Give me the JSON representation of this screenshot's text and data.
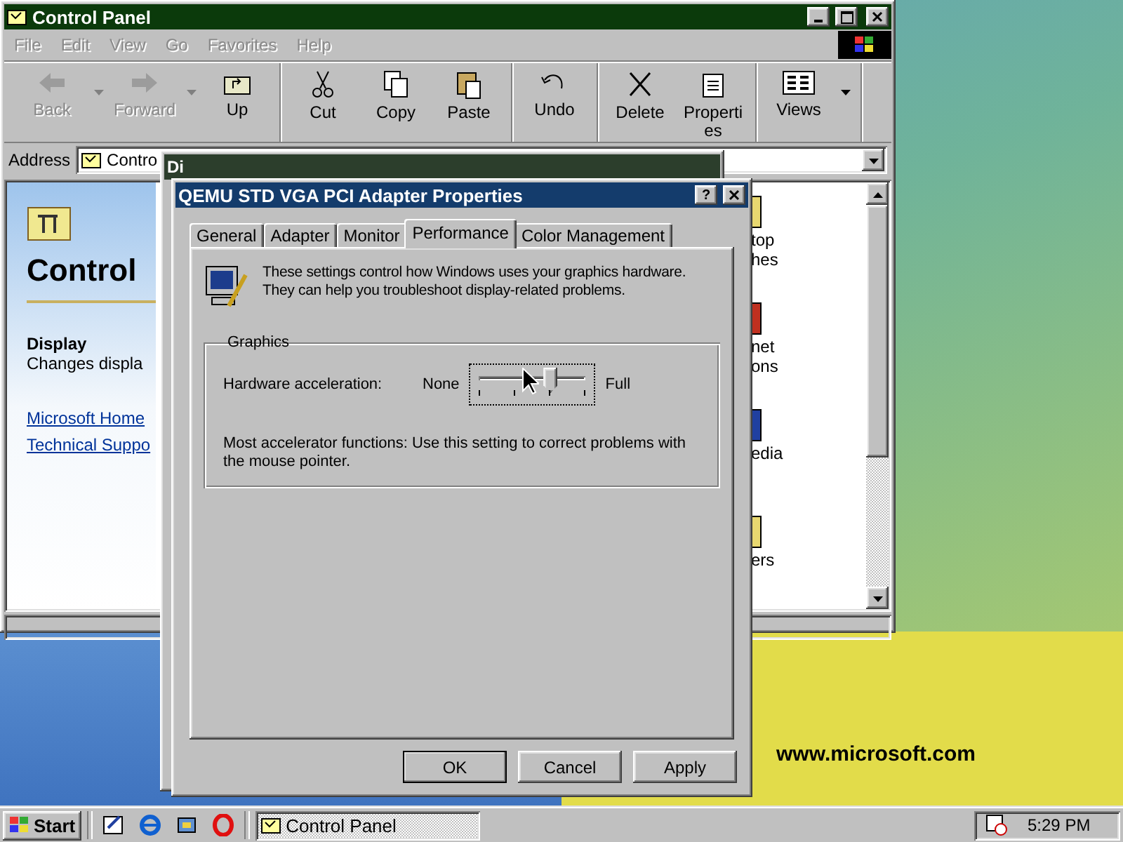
{
  "control_panel": {
    "title": "Control Panel",
    "menu": [
      "File",
      "Edit",
      "View",
      "Go",
      "Favorites",
      "Help"
    ],
    "toolbar_groups": [
      [
        {
          "label": "Back",
          "disabled": true,
          "dropdown": true
        },
        {
          "label": "Forward",
          "disabled": true,
          "dropdown": true
        },
        {
          "label": "Up",
          "disabled": false,
          "dropdown": false
        }
      ],
      [
        {
          "label": "Cut",
          "disabled": false,
          "dropdown": false
        },
        {
          "label": "Copy",
          "disabled": false,
          "dropdown": false
        },
        {
          "label": "Paste",
          "disabled": false,
          "dropdown": false
        }
      ],
      [
        {
          "label": "Undo",
          "disabled": false,
          "dropdown": false
        }
      ],
      [
        {
          "label": "Delete",
          "disabled": false,
          "dropdown": false
        },
        {
          "label": "Properties",
          "disabled": false,
          "dropdown": false
        }
      ],
      [
        {
          "label": "Views",
          "disabled": false,
          "dropdown": true
        }
      ]
    ],
    "address": {
      "label": "Address",
      "value": "Contro"
    },
    "web_panel": {
      "heading": "Control",
      "item_title": "Display",
      "item_description": "Changes displa",
      "links": [
        "Microsoft Home",
        "Technical Suppo"
      ]
    },
    "icon_labels": [
      {
        "lines": [
          "top",
          "hes"
        ]
      },
      {
        "lines": [
          "net",
          "ons"
        ]
      },
      {
        "lines": [
          "edia"
        ]
      },
      {
        "lines": [
          "ers"
        ]
      }
    ]
  },
  "background_dialog": {
    "title": "Di"
  },
  "dialog": {
    "title": "QEMU STD VGA PCI Adapter Properties",
    "help_button": "?",
    "tabs": [
      {
        "label": "General",
        "selected": false
      },
      {
        "label": "Adapter",
        "selected": false
      },
      {
        "label": "Monitor",
        "selected": false
      },
      {
        "label": "Performance",
        "selected": true
      },
      {
        "label": "Color Management",
        "selected": false
      }
    ],
    "intro": "These settings control how Windows uses your graphics hardware. They can help you troubleshoot display-related problems.",
    "group": {
      "title": "Graphics",
      "slider_label": "Hardware acceleration:",
      "min_label": "None",
      "max_label": "Full",
      "level": 0.67,
      "note": "Most accelerator functions: Use this setting to correct problems with the mouse pointer."
    },
    "buttons": [
      "OK",
      "Cancel",
      "Apply"
    ]
  },
  "desktop": {
    "url_text": "www.microsoft.com"
  },
  "taskbar": {
    "start": "Start",
    "tasks": [
      {
        "label": "Control Panel",
        "selected": true
      }
    ],
    "clock": "5:29 PM"
  }
}
